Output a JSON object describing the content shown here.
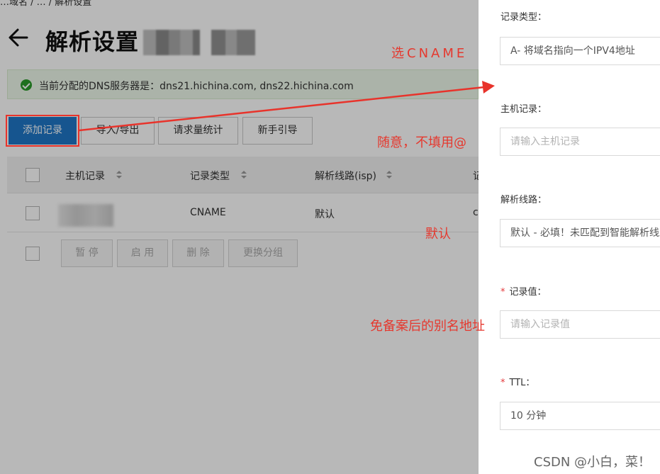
{
  "breadcrumb": "…域名 / … / 解析设置",
  "page_title": "解析设置",
  "dns_notice": "当前分配的DNS服务器是：dns21.hichina.com, dns22.hichina.com",
  "toolbar": {
    "add_record": "添加记录",
    "import_export": "导入/导出",
    "request_stats": "请求量统计",
    "guide": "新手引导"
  },
  "table": {
    "headers": [
      "主机记录",
      "记录类型",
      "解析线路(isp)",
      "记"
    ],
    "rows": [
      {
        "record_type": "CNAME",
        "line": "默认",
        "value_partial": "c"
      }
    ]
  },
  "batch_actions": [
    "暂 停",
    "启 用",
    "删 除",
    "更换分组"
  ],
  "form": {
    "record_type_label": "记录类型：",
    "record_type_value": "A- 将域名指向一个IPV4地址",
    "host_label": "主机记录：",
    "host_placeholder": "请输入主机记录",
    "line_label": "解析线路：",
    "line_value": "默认 - 必填！未匹配到智能解析线路时",
    "value_label": "记录值：",
    "value_placeholder": "请输入记录值",
    "ttl_label": "TTL：",
    "ttl_value": "10 分钟",
    "required_mark": "*"
  },
  "annotations": {
    "choose_cname": "选CNAME",
    "host_hint": "随意，不填用@",
    "line_hint": "默认",
    "value_hint": "免备案后的别名地址"
  },
  "watermark": "CSDN @小白，菜！",
  "colors": {
    "primary": "#1f77c7",
    "annotation": "#e5392f",
    "success": "#2a9b2a"
  }
}
